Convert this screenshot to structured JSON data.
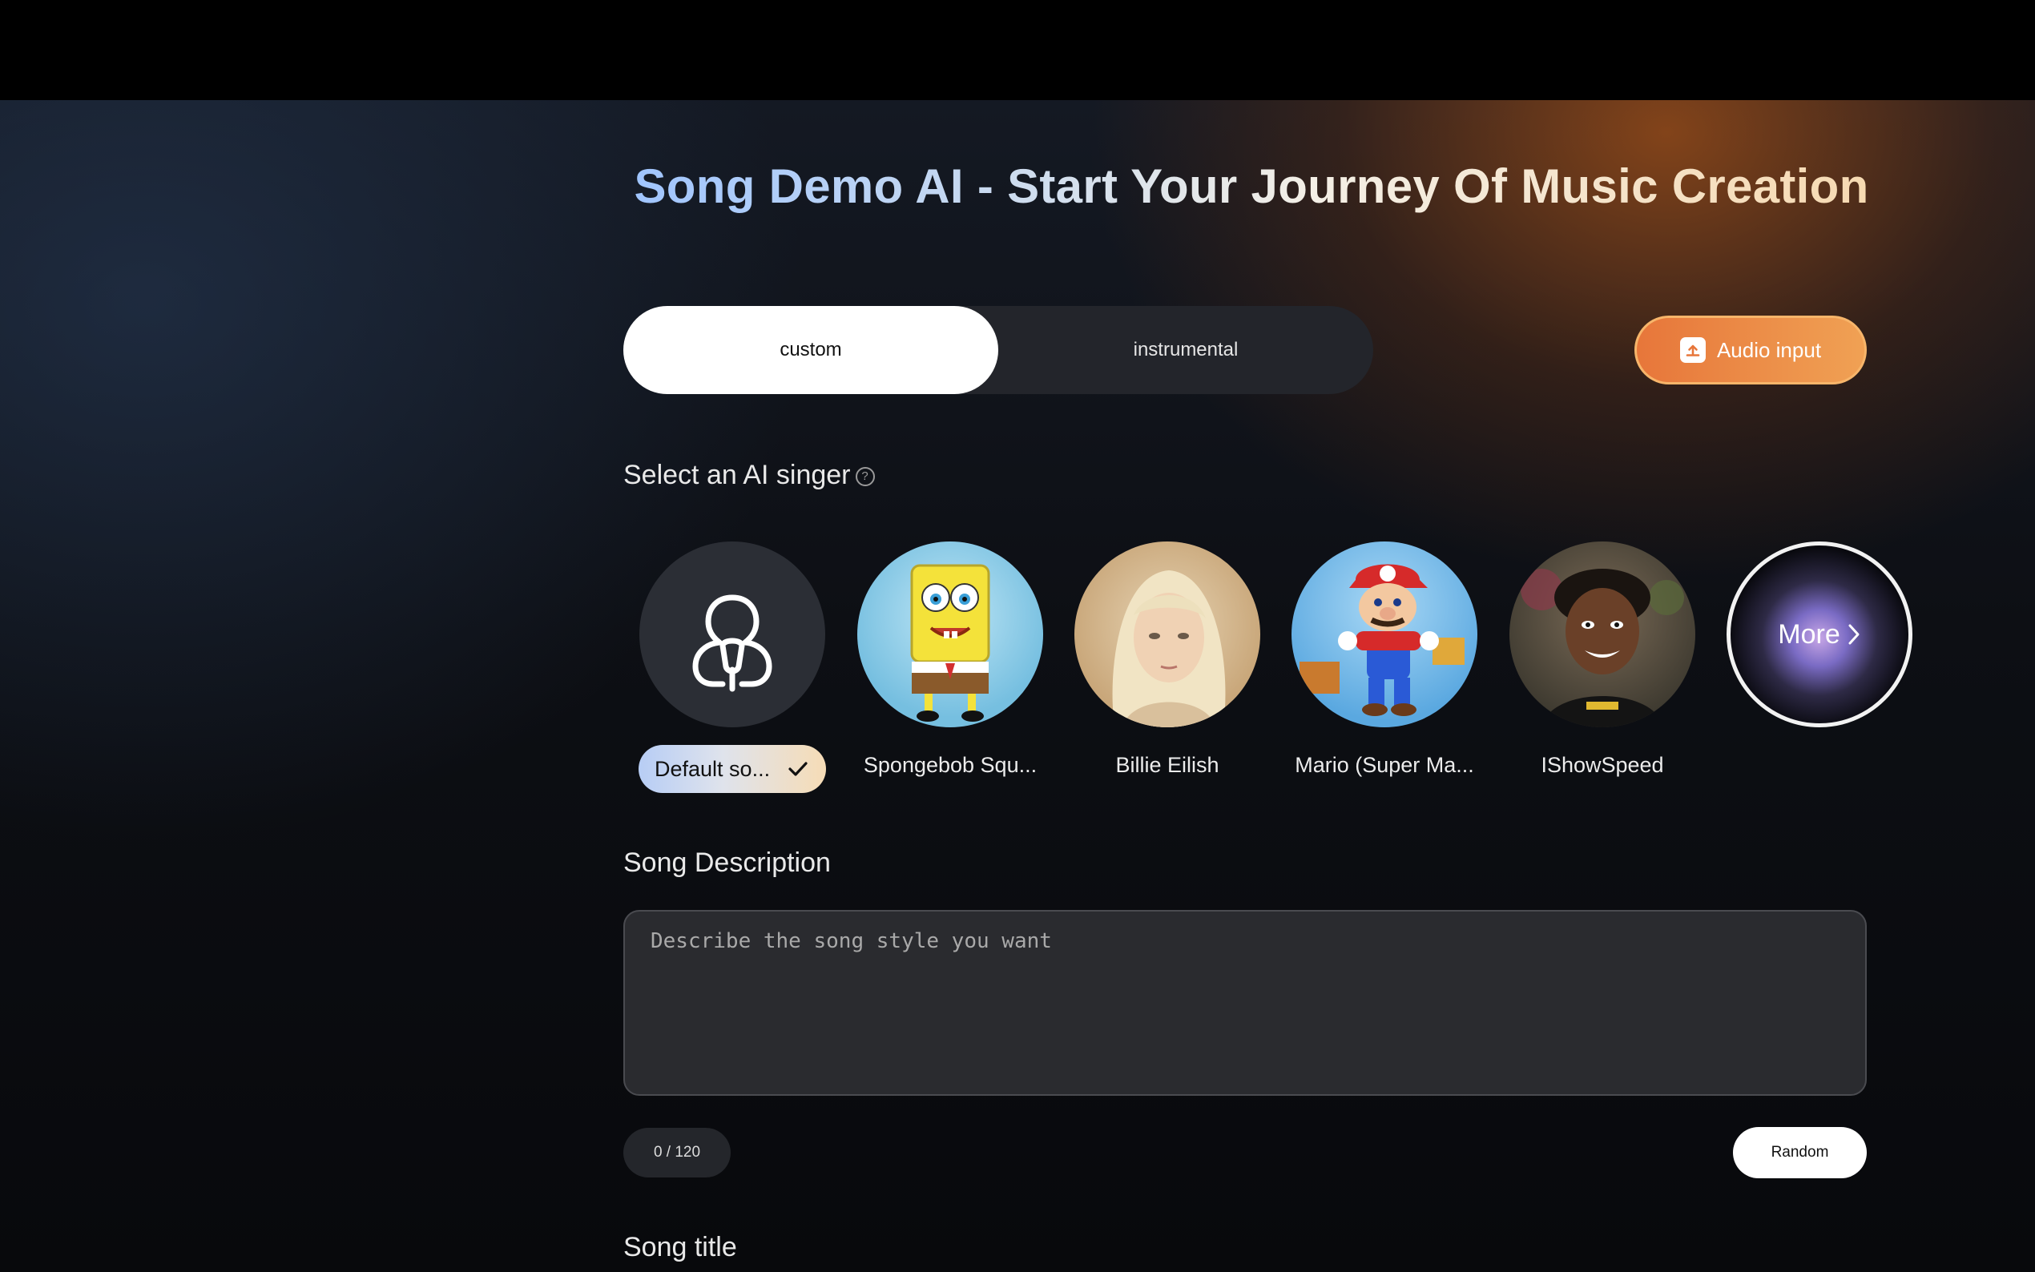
{
  "page": {
    "title": "Song Demo AI - Start Your Journey Of Music Creation"
  },
  "mode": {
    "tabs": [
      "custom",
      "instrumental"
    ],
    "active": "custom"
  },
  "audio_input": {
    "label": "Audio input",
    "icon": "upload-icon"
  },
  "singer_section": {
    "label": "Select an AI singer",
    "help_icon": "help-icon",
    "singers": [
      {
        "name": "Default so...",
        "selected": true
      },
      {
        "name": "Spongebob Squ..."
      },
      {
        "name": "Billie Eilish"
      },
      {
        "name": "Mario (Super Ma..."
      },
      {
        "name": "IShowSpeed"
      }
    ],
    "more_label": "More"
  },
  "description": {
    "label": "Song Description",
    "placeholder": "Describe the song style you want",
    "counter": "0 / 120",
    "random_label": "Random"
  },
  "title_section": {
    "label": "Song title"
  },
  "colors": {
    "accent_orange": "#e7763a",
    "background": "#0d0f14"
  }
}
